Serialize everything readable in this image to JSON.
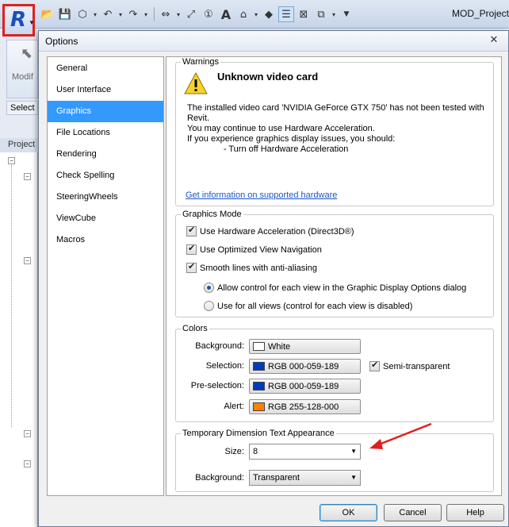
{
  "app": {
    "title": "MOD_Project",
    "button_letter": "R",
    "ribbon_modify_label": "Modif",
    "select_label": "Select",
    "project_label": "Project"
  },
  "dialog": {
    "title": "Options",
    "close_glyph": "✕",
    "nav": [
      {
        "label": "General"
      },
      {
        "label": "User Interface"
      },
      {
        "label": "Graphics"
      },
      {
        "label": "File Locations"
      },
      {
        "label": "Rendering"
      },
      {
        "label": "Check Spelling"
      },
      {
        "label": "SteeringWheels"
      },
      {
        "label": "ViewCube"
      },
      {
        "label": "Macros"
      }
    ],
    "selected_nav": "Graphics",
    "warnings": {
      "legend": "Warnings",
      "title": "Unknown video card",
      "lines": [
        "The installed video card 'NVIDIA GeForce GTX 750' has not been tested with",
        "Revit.",
        "You may continue to use Hardware Acceleration.",
        "If you experience graphics display issues, you should:",
        "               - Turn off Hardware Acceleration"
      ],
      "link": "Get information on supported hardware"
    },
    "graphics_mode": {
      "legend": "Graphics Mode",
      "checkboxes": [
        {
          "label": "Use Hardware Acceleration (Direct3D®)",
          "checked": true
        },
        {
          "label": "Use Optimized View Navigation",
          "checked": true
        },
        {
          "label": "Smooth lines with anti-aliasing",
          "checked": true
        }
      ],
      "radios": [
        {
          "label": "Allow control for each view in the Graphic Display Options dialog",
          "selected": true
        },
        {
          "label": "Use for all views (control for each view is disabled)",
          "selected": false
        }
      ]
    },
    "colors": {
      "legend": "Colors",
      "items": [
        {
          "label": "Background:",
          "value": "White",
          "swatch": "#ffffff"
        },
        {
          "label": "Selection:",
          "value": "RGB 000-059-189",
          "swatch": "#003bbd"
        },
        {
          "label": "Pre-selection:",
          "value": "RGB 000-059-189",
          "swatch": "#003bbd"
        },
        {
          "label": "Alert:",
          "value": "RGB 255-128-000",
          "swatch": "#ff8000"
        }
      ],
      "semi_transparent": {
        "label": "Semi-transparent",
        "checked": true
      }
    },
    "temp_dim": {
      "legend": "Temporary Dimension Text Appearance",
      "size_label": "Size:",
      "size_value": "8",
      "background_label": "Background:",
      "background_value": "Transparent"
    },
    "buttons": {
      "ok": "OK",
      "cancel": "Cancel",
      "help": "Help"
    }
  },
  "annotation_color": "#e02020"
}
